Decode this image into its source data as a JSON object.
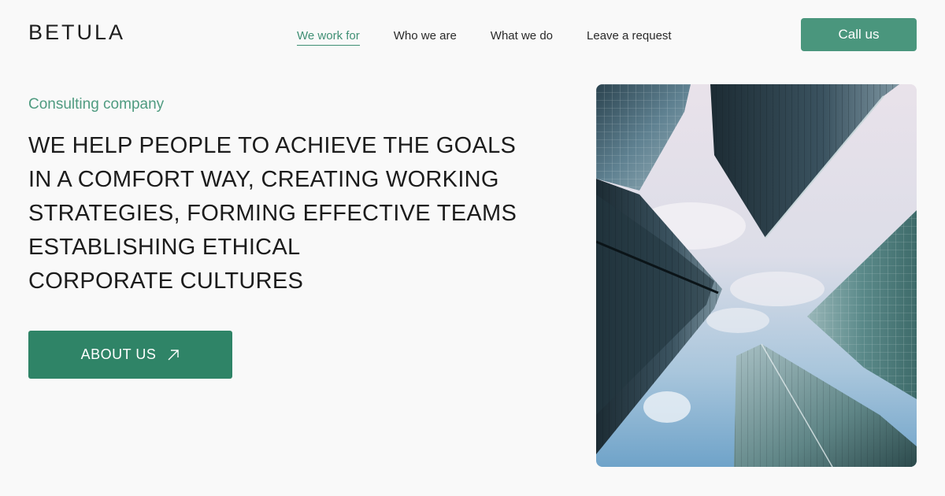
{
  "brand": {
    "logo": "BETULA"
  },
  "nav": {
    "items": [
      {
        "label": "We work for",
        "active": true
      },
      {
        "label": "Who we are",
        "active": false
      },
      {
        "label": "What we do",
        "active": false
      },
      {
        "label": "Leave a request",
        "active": false
      }
    ]
  },
  "header": {
    "cta_label": "Call us"
  },
  "hero": {
    "eyebrow": "Consulting company",
    "headline_lines": [
      "WE HELP PEOPLE TO ACHIEVE THE GOALS",
      "IN A COMFORT WAY, CREATING WORKING",
      "STRATEGIES, FORMING EFFECTIVE TEAMS",
      "ESTABLISHING ETHICAL",
      "CORPORATE CULTURES"
    ],
    "button_label": "ABOUT US",
    "button_icon": "arrow-up-right-icon",
    "image": "skyscrapers-looking-up"
  },
  "colors": {
    "accent": "#4a967d",
    "accent_dark": "#2f8467",
    "accent_text": "#4f9b80",
    "background": "#f9f9f9",
    "text": "#1c1c1c"
  }
}
